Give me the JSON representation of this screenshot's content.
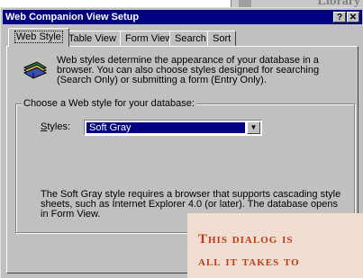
{
  "background_window": {
    "title": "Library"
  },
  "dialog": {
    "title": "Web Companion View Setup",
    "help_glyph": "?",
    "close_glyph": "✕"
  },
  "tabs": [
    {
      "label": "Web Style",
      "active": true
    },
    {
      "label": "Table View",
      "active": false
    },
    {
      "label": "Form View",
      "active": false
    },
    {
      "label": "Search",
      "active": false
    },
    {
      "label": "Sort",
      "active": false
    }
  ],
  "intro": {
    "icon": "web-styles-icon",
    "text": "Web styles determine the appearance of your database in a browser. You can also choose styles designed for searching (Search Only) or submitting a form (Entry Only)."
  },
  "group": {
    "label": "Choose a Web style for your database:",
    "styles_label_underlined": "S",
    "styles_label_rest": "tyles:",
    "selected_style": "Soft Gray",
    "dropdown_arrow": "▼",
    "description": "The Soft Gray style requires a browser that supports cascading style sheets, such as Internet Explorer 4.0 (or later). The database opens in Form View."
  },
  "callout": {
    "line1": "This dialog is",
    "line2": "all it takes to"
  },
  "colors": {
    "title_bar": "#000080",
    "face": "#c0c0c0",
    "callout_bg": "#f2ddd2",
    "callout_text": "#c23a12"
  }
}
